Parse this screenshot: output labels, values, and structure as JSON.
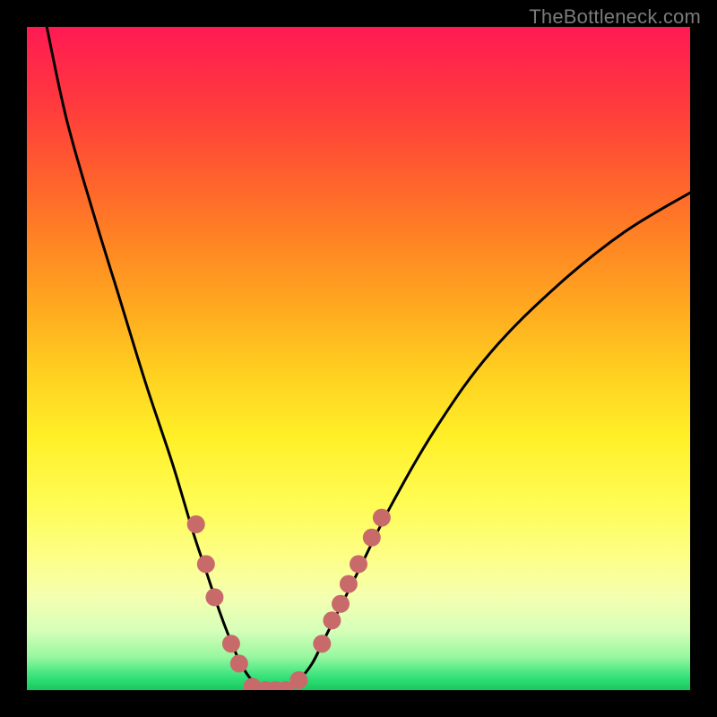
{
  "watermark": "TheBottleneck.com",
  "chart_data": {
    "type": "line",
    "title": "",
    "xlabel": "",
    "ylabel": "",
    "xlim": [
      0,
      100
    ],
    "ylim": [
      0,
      100
    ],
    "series": [
      {
        "name": "left-curve",
        "x": [
          3,
          6,
          10,
          14,
          18,
          22,
          25,
          27,
          29,
          30.5,
          32,
          33.5,
          35,
          37
        ],
        "y": [
          100,
          86,
          72,
          59,
          46,
          34,
          24,
          18,
          12,
          8,
          4.5,
          2,
          0.7,
          0
        ]
      },
      {
        "name": "right-curve",
        "x": [
          39,
          41,
          43,
          45,
          47,
          50,
          55,
          62,
          70,
          80,
          90,
          100
        ],
        "y": [
          0,
          1.5,
          4,
          8,
          12,
          18,
          28,
          40,
          51,
          61,
          69,
          75
        ]
      }
    ],
    "markers": {
      "name": "highlight-dots",
      "style": "filled-circle",
      "color": "#c96a6a",
      "radius_px": 10,
      "points": [
        {
          "x": 25.5,
          "y": 25
        },
        {
          "x": 27.0,
          "y": 19
        },
        {
          "x": 28.3,
          "y": 14
        },
        {
          "x": 30.8,
          "y": 7
        },
        {
          "x": 32.0,
          "y": 4
        },
        {
          "x": 34.0,
          "y": 0.5
        },
        {
          "x": 36.0,
          "y": 0
        },
        {
          "x": 37.5,
          "y": 0
        },
        {
          "x": 39.0,
          "y": 0
        },
        {
          "x": 41.0,
          "y": 1.5
        },
        {
          "x": 44.5,
          "y": 7
        },
        {
          "x": 46.0,
          "y": 10.5
        },
        {
          "x": 47.3,
          "y": 13
        },
        {
          "x": 48.5,
          "y": 16
        },
        {
          "x": 50.0,
          "y": 19
        },
        {
          "x": 52.0,
          "y": 23
        },
        {
          "x": 53.5,
          "y": 26
        }
      ]
    },
    "gradient_stops": [
      {
        "pos": 0.0,
        "color": "#ff1a53"
      },
      {
        "pos": 0.12,
        "color": "#ff3b3d"
      },
      {
        "pos": 0.22,
        "color": "#ff5e2e"
      },
      {
        "pos": 0.32,
        "color": "#ff8324"
      },
      {
        "pos": 0.42,
        "color": "#ffa81f"
      },
      {
        "pos": 0.52,
        "color": "#ffcf20"
      },
      {
        "pos": 0.62,
        "color": "#fff028"
      },
      {
        "pos": 0.72,
        "color": "#fffc55"
      },
      {
        "pos": 0.8,
        "color": "#fdff88"
      },
      {
        "pos": 0.86,
        "color": "#f4ffb0"
      },
      {
        "pos": 0.91,
        "color": "#d6ffba"
      },
      {
        "pos": 0.95,
        "color": "#98f7a0"
      },
      {
        "pos": 0.98,
        "color": "#35e27a"
      },
      {
        "pos": 1.0,
        "color": "#16c85e"
      }
    ]
  }
}
